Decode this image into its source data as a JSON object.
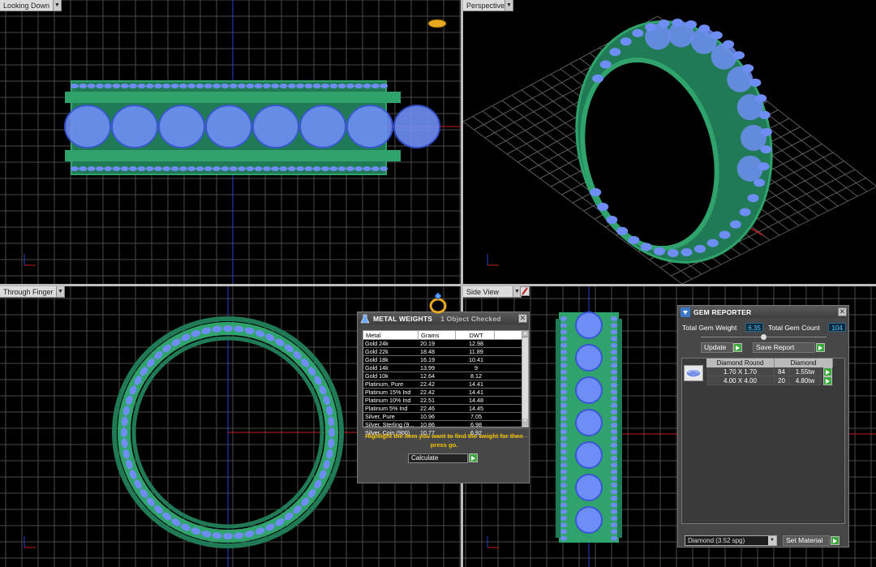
{
  "viewports": {
    "top_left": {
      "label": "Looking Down"
    },
    "top_right": {
      "label": "Perspective"
    },
    "bottom_left": {
      "label": "Through Finger"
    },
    "bottom_right": {
      "label": "Side View"
    }
  },
  "metal_weights": {
    "title": "METAL WEIGHTS",
    "status": "1 Object Checked",
    "columns": [
      "Metal",
      "Grams",
      "DWT"
    ],
    "rows": [
      [
        "Gold 24k",
        "20.19",
        "12.98"
      ],
      [
        "Gold 22k",
        "18.48",
        "11.89"
      ],
      [
        "Gold 18k",
        "16.19",
        "10.41"
      ],
      [
        "Gold 14k",
        "13.99",
        "9"
      ],
      [
        "Gold 10k",
        "12.64",
        "8.12"
      ],
      [
        "Platinum, Pure",
        "22.42",
        "14.41"
      ],
      [
        "Platinum 15% Ind",
        "22.42",
        "14.41"
      ],
      [
        "Platinum 10% Ind",
        "22.51",
        "14.48"
      ],
      [
        "Platinum 5% Ind",
        "22.46",
        "14.45"
      ],
      [
        "Silver, Pure",
        "10.96",
        "7.05"
      ],
      [
        "Silver, Sterling (9...",
        "10.86",
        "6.98"
      ],
      [
        "Silver, Coin (900)",
        "10.77",
        "6.92"
      ]
    ],
    "message": "Highlight the item you want to find the weight for then press go.",
    "calculate_label": "Calculate"
  },
  "gem_reporter": {
    "title": "GEM REPORTER",
    "total_weight_label": "Total Gem Weight",
    "total_weight_value": "6.35",
    "total_count_label": "Total Gem Count",
    "total_count_value": "104",
    "update_label": "Update",
    "save_report_label": "Save Report",
    "group_name": "Diamond Round",
    "group_material": "Diamond",
    "rows": [
      {
        "size": "1.70 X 1.70",
        "count": "84",
        "weight": "1.55tw"
      },
      {
        "size": "4.00 X 4.00",
        "count": "20",
        "weight": "4.80tw"
      }
    ],
    "material_select": "Diamond   (3.52 spg)",
    "set_material_label": "Set Material"
  },
  "colors": {
    "band_green": "#2fa36b",
    "gem_blue": "#6f8ef5",
    "grid_gray": "#4a4a4a",
    "axis_red": "#c81e1e",
    "axis_blue": "#2a3fd6",
    "message_yellow": "#f2c200"
  }
}
